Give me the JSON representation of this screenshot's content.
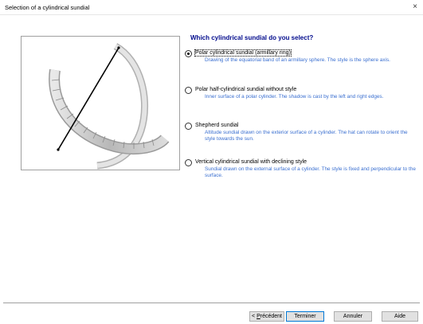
{
  "window": {
    "title": "Selection of a cylindrical sundial",
    "close_glyph": "×"
  },
  "heading": "Which cylindrical sundial do you select?",
  "options": [
    {
      "label": "Polar cylindrical sundial (armillary ring)",
      "description": "Drawing of the equatorial band of an armillary sphere. The style is the sphere axis.",
      "selected": true
    },
    {
      "label": "Polar half-cylindrical sundial without style",
      "description": "Inner surface of a polar cylinder. The shadow is cast by the left and right edges.",
      "selected": false
    },
    {
      "label": "Shepherd sundial",
      "description": "Altitude sundial drawn on the exterior surface of a cylinder. The hat can rotate to orient the style towards the sun.",
      "selected": false
    },
    {
      "label": "Vertical cylindrical sundial with declining style",
      "description": "Sundial drawn on the external surface of a cylinder. The style is fixed and perpendicular to the surface.",
      "selected": false
    }
  ],
  "buttons": {
    "previous_prefix": "< ",
    "previous_underlined": "P",
    "previous_rest": "récédent",
    "finish": "Terminer",
    "cancel": "Annuler",
    "help": "Aide"
  },
  "colors": {
    "heading": "#000a8c",
    "description": "#3a6fd0",
    "default_button_border": "#0078d7"
  },
  "icons": {
    "close": "close-icon",
    "radio": "radio-button"
  }
}
